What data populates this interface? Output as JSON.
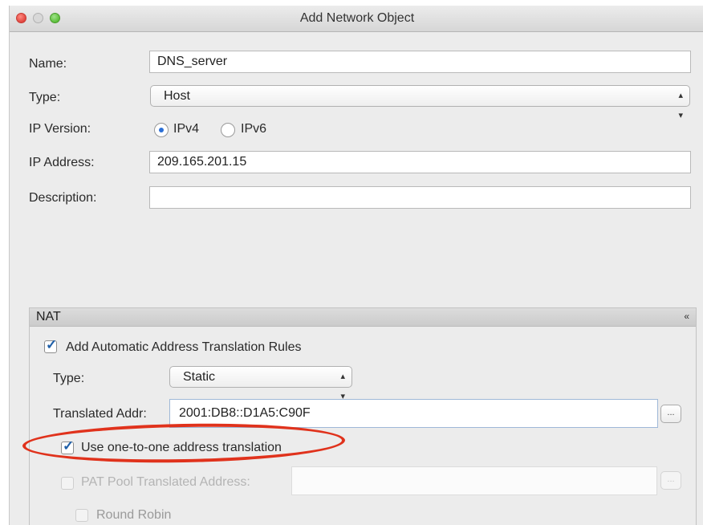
{
  "window": {
    "title": "Add Network Object"
  },
  "form": {
    "name_label": "Name:",
    "name_value": "DNS_server",
    "type_label": "Type:",
    "type_value": "Host",
    "ip_version_label": "IP Version:",
    "ipv4_label": "IPv4",
    "ipv6_label": "IPv6",
    "ip_version_selected": "IPv4",
    "ip_address_label": "IP Address:",
    "ip_address_value": "209.165.201.15",
    "description_label": "Description:",
    "description_value": ""
  },
  "nat": {
    "header": "NAT",
    "auto_rules_label": "Add Automatic Address Translation Rules",
    "auto_rules_checked": true,
    "type_label": "Type:",
    "type_value": "Static",
    "translated_addr_label": "Translated Addr:",
    "translated_addr_value": "2001:DB8::D1A5:C90F",
    "browse_label": "...",
    "one_to_one_label": "Use one-to-one address translation",
    "one_to_one_checked": true,
    "pat_pool_label": "PAT Pool Translated Address:",
    "pat_pool_checked": false,
    "pat_pool_value": "",
    "round_robin_label": "Round Robin",
    "round_robin_checked": false
  },
  "annotation": {
    "highlight_color": "#e0321c"
  },
  "colors": {
    "window_bg": "#ececec",
    "accent": "#2b6fd6",
    "check": "#1f5fa8"
  }
}
